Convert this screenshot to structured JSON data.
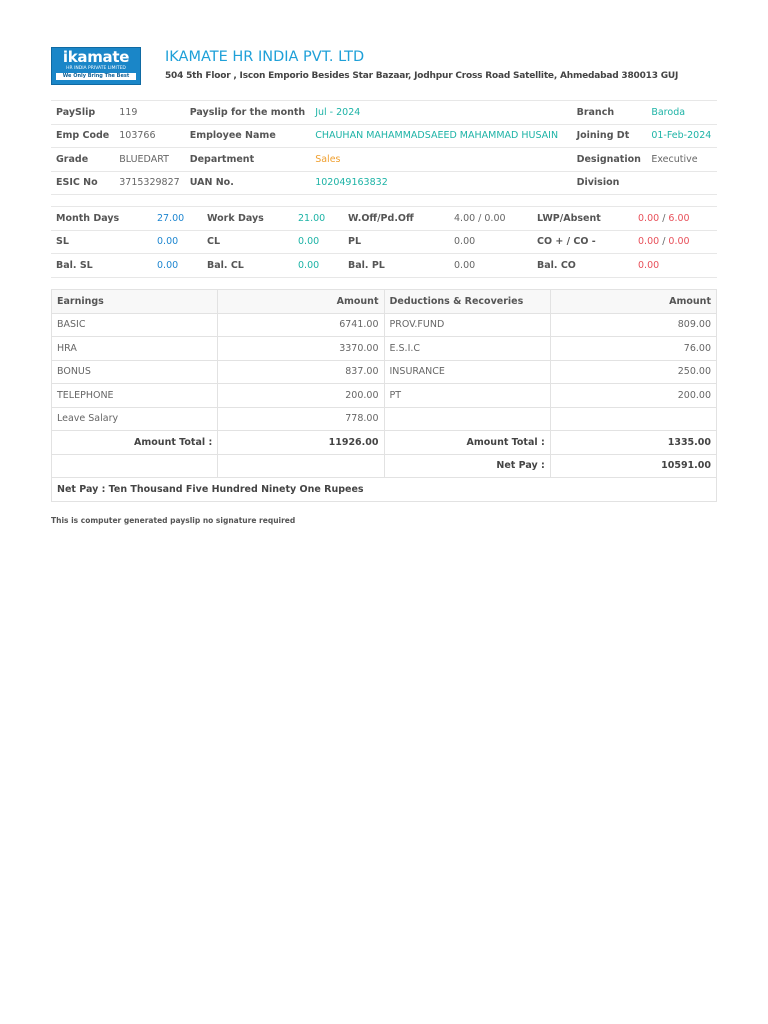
{
  "logo": {
    "brand": "ikamate",
    "subtitle": "HR INDIA PRIVATE LIMITED",
    "tagline": "We Only Bring The Best"
  },
  "company": {
    "name": "IKAMATE HR INDIA PVT. LTD",
    "address": "504 5th Floor , Iscon Emporio   Besides Star Bazaar, Jodhpur Cross Road   Satellite, Ahmedabad 380013 GUJ"
  },
  "employee": {
    "payslip_label": "PaySlip",
    "payslip_no": "119",
    "month_label": "Payslip for the month",
    "month": "Jul - 2024",
    "branch_label": "Branch",
    "branch": "Baroda",
    "emp_code_label": "Emp Code",
    "emp_code": "103766",
    "name_label": "Employee Name",
    "name": "CHAUHAN MAHAMMADSAEED MAHAMMAD HUSAIN",
    "joining_label": "Joining Dt",
    "joining": "01-Feb-2024",
    "grade_label": "Grade",
    "grade": "BLUEDART",
    "dept_label": "Department",
    "dept": "Sales",
    "designation_label": "Designation",
    "designation": "Executive",
    "esic_label": "ESIC No",
    "esic": "3715329827",
    "uan_label": "UAN No.",
    "uan": "102049163832",
    "division_label": "Division",
    "division": ""
  },
  "attendance": {
    "month_days_label": "Month Days",
    "month_days": "27.00",
    "work_days_label": "Work Days",
    "work_days": "21.00",
    "woff_label": "W.Off/Pd.Off",
    "woff": "4.00 / 0.00",
    "lwp_label": "LWP/Absent",
    "lwp_a": "0.00",
    "lwp_b": "6.00",
    "sl_label": "SL",
    "sl": "0.00",
    "cl_label": "CL",
    "cl": "0.00",
    "pl_label": "PL",
    "pl": "0.00",
    "co_label": "CO + / CO -",
    "co_a": "0.00",
    "co_b": "0.00",
    "bal_sl_label": "Bal. SL",
    "bal_sl": "0.00",
    "bal_cl_label": "Bal. CL",
    "bal_cl": "0.00",
    "bal_pl_label": "Bal. PL",
    "bal_pl": "0.00",
    "bal_co_label": "Bal. CO",
    "bal_co": "0.00",
    "sep": "/"
  },
  "salary": {
    "headers": [
      "Earnings",
      "Amount",
      "Deductions & Recoveries",
      "Amount"
    ],
    "rows": [
      [
        "BASIC",
        "6741.00",
        "PROV.FUND",
        "809.00"
      ],
      [
        "HRA",
        "3370.00",
        "E.S.I.C",
        "76.00"
      ],
      [
        "BONUS",
        "837.00",
        "INSURANCE",
        "250.00"
      ],
      [
        "TELEPHONE",
        "200.00",
        "PT",
        "200.00"
      ],
      [
        "Leave Salary",
        "778.00",
        "",
        ""
      ]
    ],
    "total_label": "Amount Total :",
    "earnings_total": "11926.00",
    "deductions_total": "1335.00",
    "net_pay_label": "Net Pay :",
    "net_pay": "10591.00",
    "net_pay_words": "Net Pay : Ten Thousand Five Hundred Ninety One Rupees"
  },
  "footer": {
    "note": "This is computer generated payslip no signature required"
  }
}
